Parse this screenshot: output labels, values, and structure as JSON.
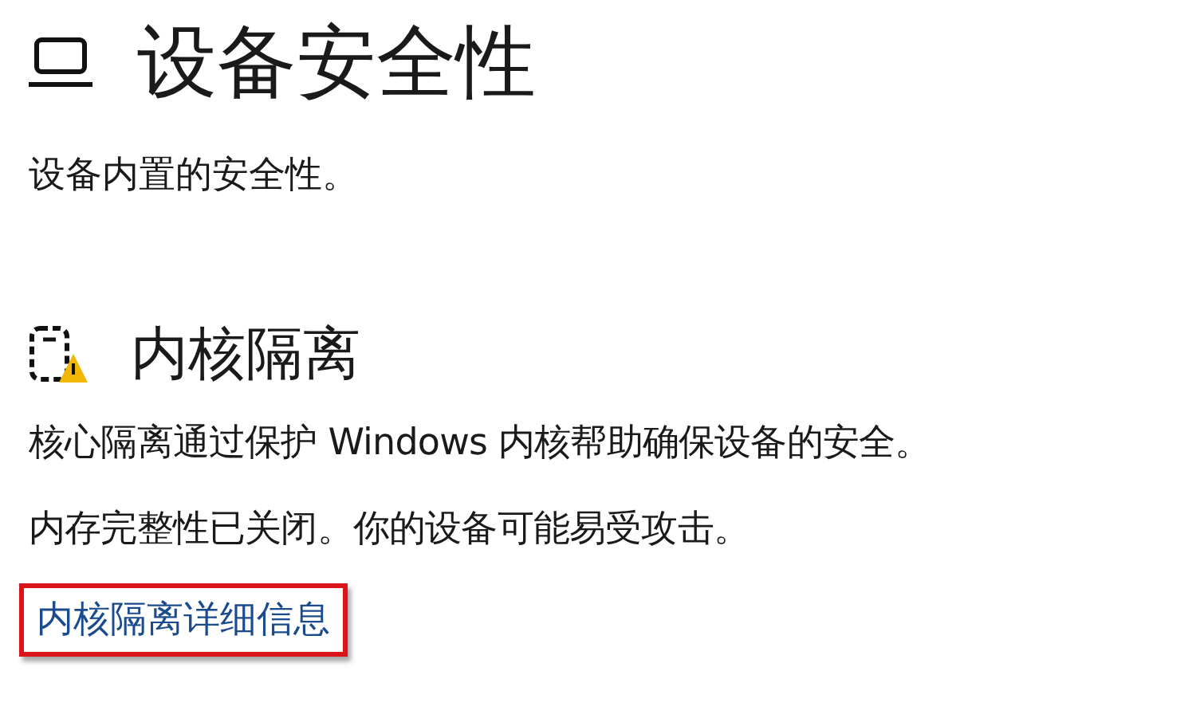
{
  "page": {
    "title": "设备安全性",
    "subtitle": "设备内置的安全性。"
  },
  "section": {
    "title": "内核隔离",
    "warning": true,
    "lines": [
      "核心隔离通过保护 Windows 内核帮助确保设备的安全。",
      "内存完整性已关闭。你的设备可能易受攻击。"
    ],
    "link": {
      "label": "内核隔离详细信息",
      "highlighted": true
    }
  }
}
